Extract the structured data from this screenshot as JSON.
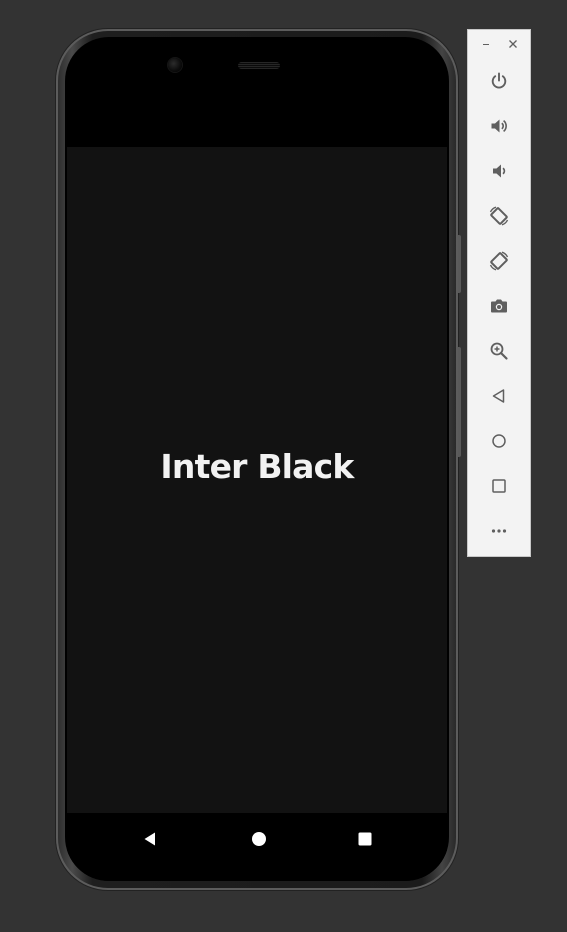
{
  "app": {
    "display_text": "Inter Black"
  },
  "colors": {
    "desktop_background": "#333333",
    "app_background": "#121212",
    "app_text": "#f2f2f2",
    "toolbar_background": "#f3f3f3",
    "toolbar_icon": "#5f5f5f"
  },
  "toolbar": {
    "window_controls": [
      "minimize-icon",
      "close-icon"
    ],
    "buttons": [
      "power-icon",
      "volume-up-icon",
      "volume-down-icon",
      "rotate-left-icon",
      "rotate-right-icon",
      "camera-icon",
      "zoom-icon",
      "back-icon",
      "home-icon",
      "overview-icon",
      "more-icon"
    ]
  },
  "navigation_bar": {
    "buttons": [
      "back-icon",
      "home-icon",
      "recents-icon"
    ]
  }
}
